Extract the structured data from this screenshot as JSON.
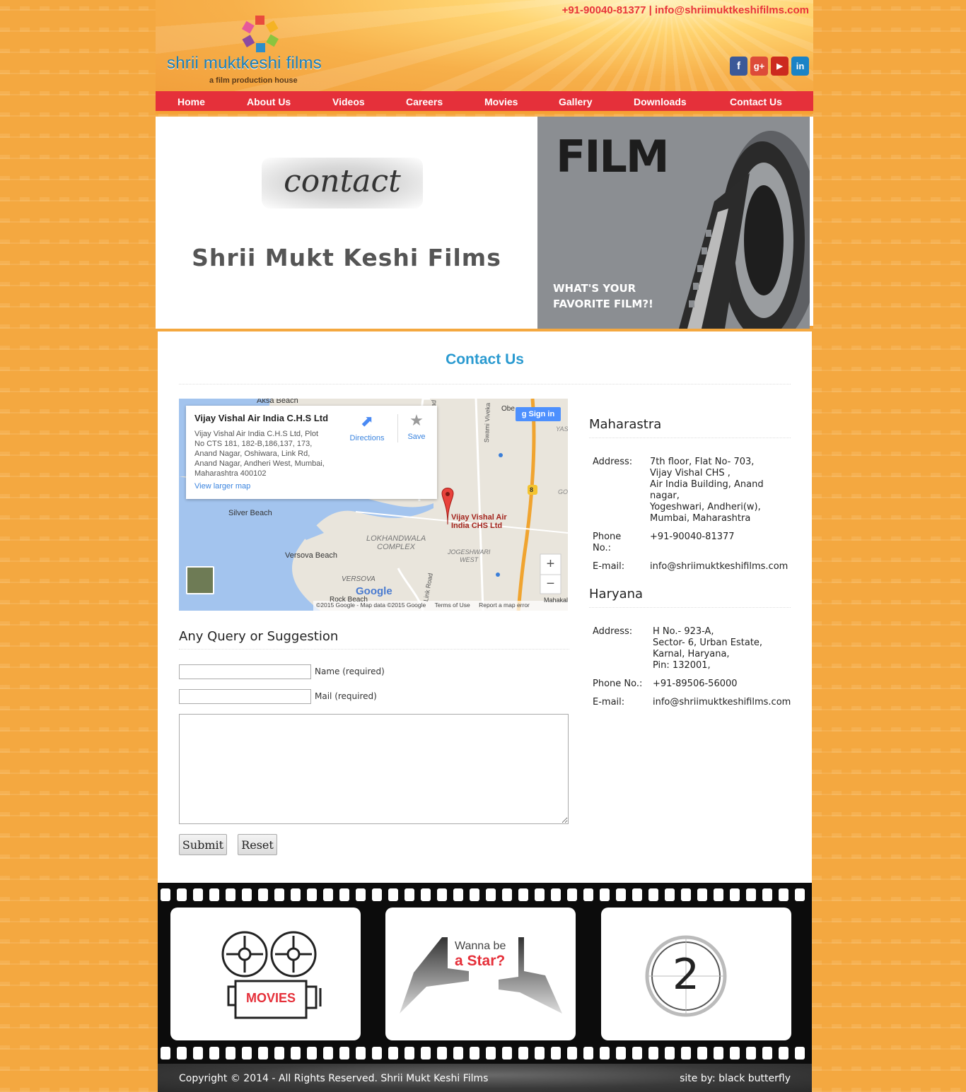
{
  "header": {
    "phone": "+91-90040-81377",
    "separator": "|",
    "email": "info@shriimuktkeshifilms.com",
    "logo_name": "shrii muktkeshi films",
    "logo_tagline": "a film production house",
    "social": [
      {
        "name": "facebook-icon",
        "glyph": "f",
        "color": "#3b5998"
      },
      {
        "name": "google-plus-icon",
        "glyph": "g+",
        "color": "#dd4b39"
      },
      {
        "name": "youtube-icon",
        "glyph": "▶",
        "color": "#cc2a1f"
      },
      {
        "name": "linkedin-icon",
        "glyph": "in",
        "color": "#1a83c6"
      }
    ]
  },
  "nav": [
    "Home",
    "About Us",
    "Videos",
    "Careers",
    "Movies",
    "Gallery",
    "Downloads",
    "Contact Us"
  ],
  "banner": {
    "script_word": "contact",
    "title": "Shrii Mukt Keshi Films",
    "right_word": "FILM",
    "right_question_1": "WHAT'S YOUR",
    "right_question_2": "FAVORITE FILM?!"
  },
  "main": {
    "title": "Contact Us",
    "map": {
      "place_title": "Vijay Vishal Air India C.H.S Ltd",
      "place_address": [
        "Vijay Vishal Air India C.H.S Ltd, Plot",
        "No CTS 181, 182-B,186,137, 173,",
        "Anand Nagar, Oshiwara, Link Rd,",
        "Anand Nagar, Andheri West, Mumbai,",
        "Maharashtra 400102"
      ],
      "view_larger": "View larger map",
      "directions": "Directions",
      "save": "Save",
      "sign_in": "Sign in",
      "pin_label_1": "Vijay Vishal Air",
      "pin_label_2": "India CHS Ltd",
      "labels": {
        "aksa": "Aksa Beach",
        "silver": "Silver Beach",
        "versova_beach": "Versova Beach",
        "versova": "VERSOVA",
        "lokhandwala_1": "LOKHANDWALA",
        "lokhandwala_2": "COMPLEX",
        "jogeshwari_1": "JOGESHWARI",
        "jogeshwari_2": "WEST",
        "link_road": "Link Road",
        "link_road_2": "Link Road",
        "swami": "Swami Viveka",
        "obe": "Obe",
        "yas": "YAS",
        "go": "GO",
        "rock": "Rock Beach",
        "mahakal": "Mahakal",
        "route": "8"
      },
      "google": "Google",
      "zoom_in": "+",
      "zoom_out": "−",
      "footer_copy": "©2015 Google - Map data ©2015 Google",
      "footer_terms": "Terms of Use",
      "footer_report": "Report a map error"
    },
    "form": {
      "heading": "Any Query or Suggestion",
      "name_label": "Name (required)",
      "mail_label": "Mail (required)",
      "submit": "Submit",
      "reset": "Reset"
    },
    "offices": [
      {
        "region": "Maharastra",
        "address_label": "Address:",
        "address_lines": [
          "7th floor, Flat No- 703,",
          "Vijay Vishal CHS ,",
          "Air India Building, Anand",
          "nagar,",
          "Yogeshwari, Andheri(w),",
          "Mumbai, Maharashtra"
        ],
        "phone_label_1": "Phone",
        "phone_label_2": "No.:",
        "phone": "+91-90040-81377",
        "email_label": "E-mail:",
        "email": "info@shriimuktkeshifilms.com"
      },
      {
        "region": "Haryana",
        "address_label": "Address:",
        "address_lines": [
          "H No.- 923-A,",
          "Sector- 6, Urban Estate,",
          "Karnal, Haryana,",
          "Pin: 132001,"
        ],
        "phone_label": "Phone No.:",
        "phone": "+91-89506-56000",
        "email_label": "E-mail:",
        "email": "info@shriimuktkeshifilms.com"
      }
    ]
  },
  "strip": {
    "movies": "MOVIES",
    "star_1": "Wanna be",
    "star_2": "a Star?",
    "countdown": "2"
  },
  "footer": {
    "copyright": "Copyright © 2014 - All Rights Reserved. Shrii Mukt Keshi Films",
    "credit": "site by: black butterfly"
  }
}
